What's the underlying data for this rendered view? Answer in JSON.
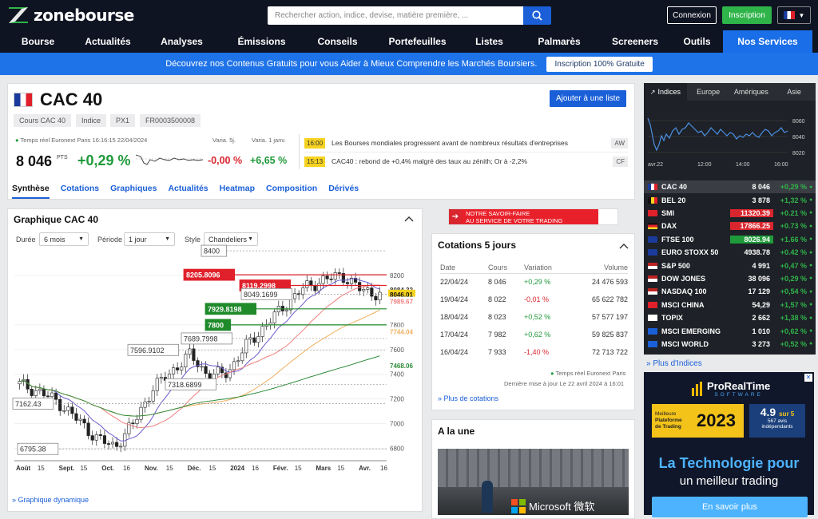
{
  "header": {
    "logo": "zonebourse",
    "search_placeholder": "Rechercher action, indice, devise, matière première, ...",
    "connexion": "Connexion",
    "inscription": "Inscription"
  },
  "nav": [
    "Bourse",
    "Actualités",
    "Analyses",
    "Émissions",
    "Conseils",
    "Portefeuilles",
    "Listes",
    "Palmarès",
    "Screeners",
    "Outils",
    "Nos Services"
  ],
  "promo": {
    "text": "Découvrez nos Contenus Gratuits pour vous Aider à Mieux Comprendre les Marchés Boursiers.",
    "button": "Inscription 100% Gratuite"
  },
  "quote": {
    "title": "CAC 40",
    "tags": [
      "Cours CAC 40",
      "Indice",
      "PX1",
      "FR0003500008"
    ],
    "add_list": "Ajouter à une liste",
    "realtime": "Temps réel Euronext Paris 16:16:15 22/04/2024",
    "price": "8 046",
    "pts": "PTS",
    "change": "+0,29 %",
    "var5j_label": "Varia. 5j.",
    "var5j": "-0,00 %",
    "var1jan_label": "Varia. 1 janv.",
    "var1jan": "+6,65 %"
  },
  "news": [
    {
      "time": "16:00",
      "text": "Les Bourses mondiales progressent avant de nombreux résultats d'entreprises",
      "src": "AW"
    },
    {
      "time": "15:13",
      "text": "CAC40 : rebond de +0,4% malgré des taux au zénith; Or à -2,2%",
      "src": "CF"
    }
  ],
  "tabs": [
    "Synthèse",
    "Cotations",
    "Graphiques",
    "Actualités",
    "Heatmap",
    "Composition",
    "Dérivés"
  ],
  "chart": {
    "title": "Graphique CAC 40",
    "duree_label": "Durée",
    "duree": "6 mois",
    "periode_label": "Période",
    "periode": "1 jour",
    "style_label": "Style",
    "style": "Chandeliers",
    "link": "» Graphique dynamique",
    "levels": [
      "8400",
      "8205.8096",
      "8119.2998",
      "8049.1699",
      "7929.8198",
      "7800",
      "7689.7998",
      "7596.9102",
      "7318.6899",
      "7162.43",
      "6795.38"
    ],
    "right_axis": [
      "8200",
      "8084.32",
      "8046.01",
      "7989.67",
      "7800",
      "7744.04",
      "7600",
      "7468.06",
      "7400",
      "7200",
      "7000",
      "6800"
    ],
    "x_labels": [
      "Août",
      "15",
      "Sept.",
      "15",
      "Oct.",
      "16",
      "Nov.",
      "15",
      "Déc.",
      "15",
      "2024",
      "16",
      "Févr.",
      "15",
      "Mars",
      "15",
      "Avr.",
      "16"
    ]
  },
  "chart_data": {
    "type": "line",
    "title": "Graphique CAC 40",
    "xlabel": "",
    "ylabel": "",
    "ylim": [
      6700,
      8420
    ],
    "x": [
      "Août",
      "Sept.",
      "Oct.",
      "Nov.",
      "Déc.",
      "2024",
      "Févr.",
      "Mars",
      "Avr."
    ],
    "series": [
      {
        "values": [
          7320,
          7260,
          7180,
          7040,
          6890,
          6810,
          7000,
          7280,
          7420,
          7560,
          7380,
          7420,
          7640,
          7800,
          7960,
          8100,
          8160,
          8205,
          8084,
          8046
        ]
      }
    ]
  },
  "ad_mid": {
    "line1": "NOTRE SAVOIR-FAIRE",
    "line2": "AU SERVICE DE VOTRE TRADING"
  },
  "cotations": {
    "title": "Cotations 5 jours",
    "headers": [
      "Date",
      "Cours",
      "Variation",
      "Volume"
    ],
    "rows": [
      {
        "date": "22/04/24",
        "cours": "8 046",
        "var": "+0,29 %",
        "vol": "24 476 593",
        "up": true
      },
      {
        "date": "19/04/24",
        "cours": "8 022",
        "var": "-0,01 %",
        "vol": "65 622 782",
        "up": false
      },
      {
        "date": "18/04/24",
        "cours": "8 023",
        "var": "+0,52 %",
        "vol": "57 577 197",
        "up": true
      },
      {
        "date": "17/04/24",
        "cours": "7 982",
        "var": "+0,62 %",
        "vol": "59 825 837",
        "up": true
      },
      {
        "date": "16/04/24",
        "cours": "7 933",
        "var": "-1,40 %",
        "vol": "72 713 722",
        "up": false
      }
    ],
    "realtime": "Temps réel Euronext Paris",
    "updated": "Dernière mise à jour Le 22 avril 2024 à 16:01",
    "more": "» Plus de cotations"
  },
  "une": {
    "title": "A la une",
    "caption": "Microsoft 微软"
  },
  "indices": {
    "tabs": [
      "Indices",
      "Europe",
      "Amériques",
      "Asie"
    ],
    "mini_axis": [
      "8060",
      "8040",
      "8020"
    ],
    "mini_x": [
      "avr.22",
      "12:00",
      "14:00",
      "16:00"
    ],
    "rows": [
      {
        "name": "CAC 40",
        "val": "8 046",
        "chg": "+0,29 %",
        "flag": "fr",
        "hl": ""
      },
      {
        "name": "BEL 20",
        "val": "3 878",
        "chg": "+1,32 %",
        "flag": "be",
        "hl": ""
      },
      {
        "name": "SMI",
        "val": "11320.39",
        "chg": "+0.21 %",
        "flag": "ch",
        "hl": "red"
      },
      {
        "name": "DAX",
        "val": "17866.25",
        "chg": "+0.73 %",
        "flag": "de",
        "hl": "red"
      },
      {
        "name": "FTSE 100",
        "val": "8026.94",
        "chg": "+1.66 %",
        "flag": "gb",
        "hl": "green"
      },
      {
        "name": "EURO STOXX 50",
        "val": "4938.78",
        "chg": "+0.42 %",
        "flag": "eu",
        "hl": ""
      },
      {
        "name": "S&P 500",
        "val": "4 991",
        "chg": "+0,47 %",
        "flag": "us",
        "hl": ""
      },
      {
        "name": "DOW JONES",
        "val": "38 096",
        "chg": "+0,29 %",
        "flag": "us",
        "hl": ""
      },
      {
        "name": "NASDAQ 100",
        "val": "17 129",
        "chg": "+0,54 %",
        "flag": "us",
        "hl": ""
      },
      {
        "name": "MSCI CHINA",
        "val": "54,29",
        "chg": "+1,57 %",
        "flag": "cn",
        "hl": ""
      },
      {
        "name": "TOPIX",
        "val": "2 662",
        "chg": "+1,38 %",
        "flag": "jp",
        "hl": ""
      },
      {
        "name": "MSCI EMERGING",
        "val": "1 010",
        "chg": "+0,62 %",
        "flag": "w",
        "hl": ""
      },
      {
        "name": "MSCI WORLD",
        "val": "3 273",
        "chg": "+0,52 %",
        "flag": "w",
        "hl": ""
      }
    ],
    "more": "» Plus d'Indices"
  },
  "ad_side": {
    "brand": "ProRealTime",
    "brand_sub": "SOFTWARE",
    "award1": "Meilleure",
    "award2": "Plateforme",
    "award3": "de Trading",
    "year": "2023",
    "rating": "4.9",
    "rating_of": "sur 5",
    "reviews": "567 avis",
    "reviews2": "indépendants",
    "headline1": "La Technologie pour",
    "headline2": "un meilleur trading",
    "cta": "En savoir plus"
  }
}
